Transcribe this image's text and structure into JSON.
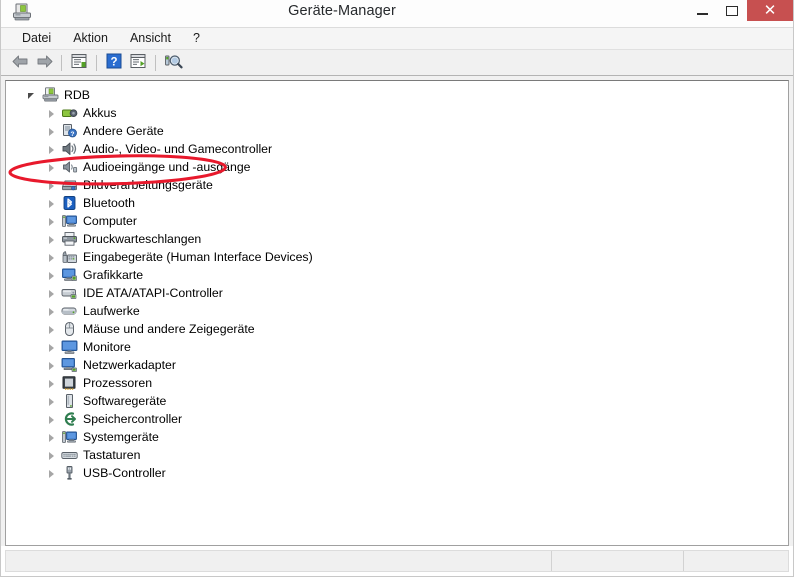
{
  "window": {
    "title": "Geräte-Manager",
    "icon": "device-manager-icon",
    "controls": {
      "minimize": "minimize-icon",
      "maximize": "maximize-icon",
      "close": "close-icon",
      "close_glyph": "✕",
      "close_color": "#c75050"
    }
  },
  "menubar": {
    "items": [
      {
        "label": "Datei",
        "name": "menu-datei"
      },
      {
        "label": "Aktion",
        "name": "menu-aktion"
      },
      {
        "label": "Ansicht",
        "name": "menu-ansicht"
      },
      {
        "label": "?",
        "name": "menu-help"
      }
    ]
  },
  "toolbar": {
    "buttons": [
      {
        "name": "back-button",
        "icon": "back-arrow-icon",
        "tooltip": "Zurück"
      },
      {
        "name": "forward-button",
        "icon": "forward-arrow-icon",
        "tooltip": "Vorwärts"
      },
      {
        "name": "properties-button",
        "icon": "properties-icon",
        "tooltip": "Eigenschaften"
      },
      {
        "name": "help-button",
        "icon": "help-question-icon",
        "tooltip": "Hilfe"
      },
      {
        "name": "show-hidden-button",
        "icon": "show-devices-icon",
        "tooltip": "Geräte anzeigen"
      },
      {
        "name": "scan-hardware-button",
        "icon": "scan-hardware-icon",
        "tooltip": "Nach geänderter Hardware suchen"
      }
    ]
  },
  "tree": {
    "root": {
      "label": "RDB",
      "icon": "computer-root-icon",
      "expanded": true
    },
    "nodes": [
      {
        "label": "Akkus",
        "icon": "battery-icon"
      },
      {
        "label": "Andere Geräte",
        "icon": "other-devices-icon"
      },
      {
        "label": "Audio-, Video- und Gamecontroller",
        "icon": "audio-speaker-icon"
      },
      {
        "label": "Audioeingänge und -ausgänge",
        "icon": "audio-io-icon"
      },
      {
        "label": "Bildverarbeitungsgeräte",
        "icon": "imaging-device-icon",
        "highlighted": true
      },
      {
        "label": "Bluetooth",
        "icon": "bluetooth-icon"
      },
      {
        "label": "Computer",
        "icon": "computer-icon"
      },
      {
        "label": "Druckwarteschlangen",
        "icon": "printer-icon"
      },
      {
        "label": "Eingabegeräte (Human Interface Devices)",
        "icon": "hid-icon"
      },
      {
        "label": "Grafikkarte",
        "icon": "display-adapter-icon"
      },
      {
        "label": "IDE ATA/ATAPI-Controller",
        "icon": "ide-controller-icon"
      },
      {
        "label": "Laufwerke",
        "icon": "disk-drive-icon"
      },
      {
        "label": "Mäuse und andere Zeigegeräte",
        "icon": "mouse-icon"
      },
      {
        "label": "Monitore",
        "icon": "monitor-icon"
      },
      {
        "label": "Netzwerkadapter",
        "icon": "network-adapter-icon"
      },
      {
        "label": "Prozessoren",
        "icon": "processor-icon"
      },
      {
        "label": "Softwaregeräte",
        "icon": "software-device-icon"
      },
      {
        "label": "Speichercontroller",
        "icon": "storage-controller-icon"
      },
      {
        "label": "Systemgeräte",
        "icon": "system-device-icon"
      },
      {
        "label": "Tastaturen",
        "icon": "keyboard-icon"
      },
      {
        "label": "USB-Controller",
        "icon": "usb-icon"
      }
    ]
  },
  "annotation": {
    "type": "ellipse-highlight",
    "color": "#e8192c",
    "target_label": "Bildverarbeitungsgeräte"
  },
  "statusbar": {
    "pane1": "",
    "pane2": "",
    "pane3": ""
  }
}
